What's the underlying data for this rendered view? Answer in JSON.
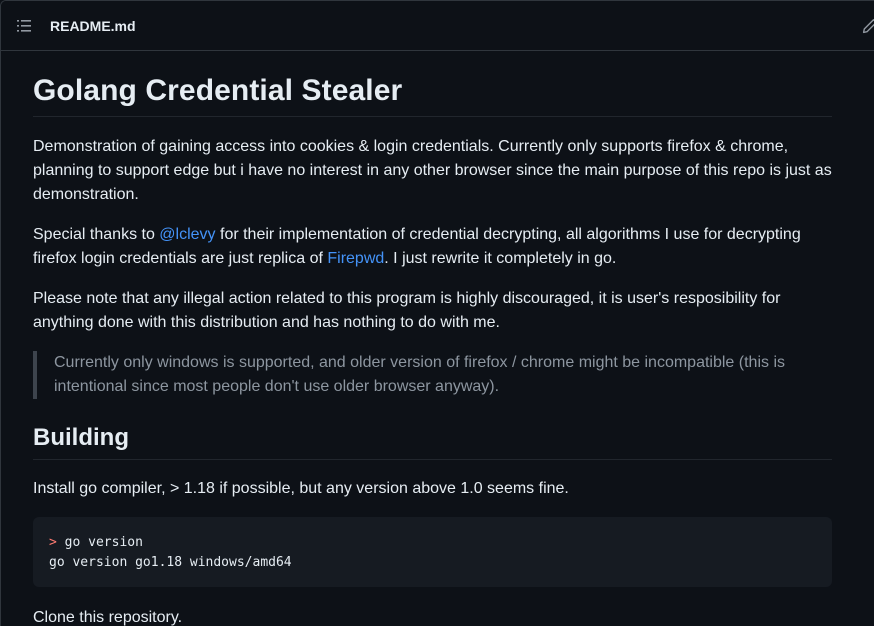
{
  "header": {
    "file_name": "README.md",
    "outline_icon": "list-unordered-icon",
    "edit_icon": "pencil-icon"
  },
  "readme": {
    "title": "Golang Credential Stealer",
    "intro": "Demonstration of gaining access into cookies & login credentials. Currently only supports firefox & chrome, planning to support edge but i have no interest in any other browser since the main purpose of this repo is just as demonstration.",
    "thanks": {
      "before": "Special thanks to ",
      "link1": "@lclevy",
      "middle": " for their implementation of credential decrypting, all algorithms I use for decrypting firefox login credentials are just replica of ",
      "link2": "Firepwd",
      "after": ". I just rewrite it completely in go."
    },
    "notice": "Please note that any illegal action related to this program is highly discouraged, it is user's resposibility for anything done with this distribution and has nothing to do with me.",
    "quote": "Currently only windows is supported, and older version of firefox / chrome might be incompatible (this is intentional since most people don't use older browser anyway).",
    "building_heading": "Building",
    "install_text": "Install go compiler, > 1.18 if possible, but any version above 1.0 seems fine.",
    "code": {
      "prompt": ">",
      "command": " go version",
      "output": "go version go1.18 windows/amd64"
    },
    "clone_text": "Clone this repository."
  },
  "colors": {
    "background": "#0d1117",
    "link": "#4493f8",
    "code_background": "#161b22",
    "prompt": "#ff7b72"
  }
}
